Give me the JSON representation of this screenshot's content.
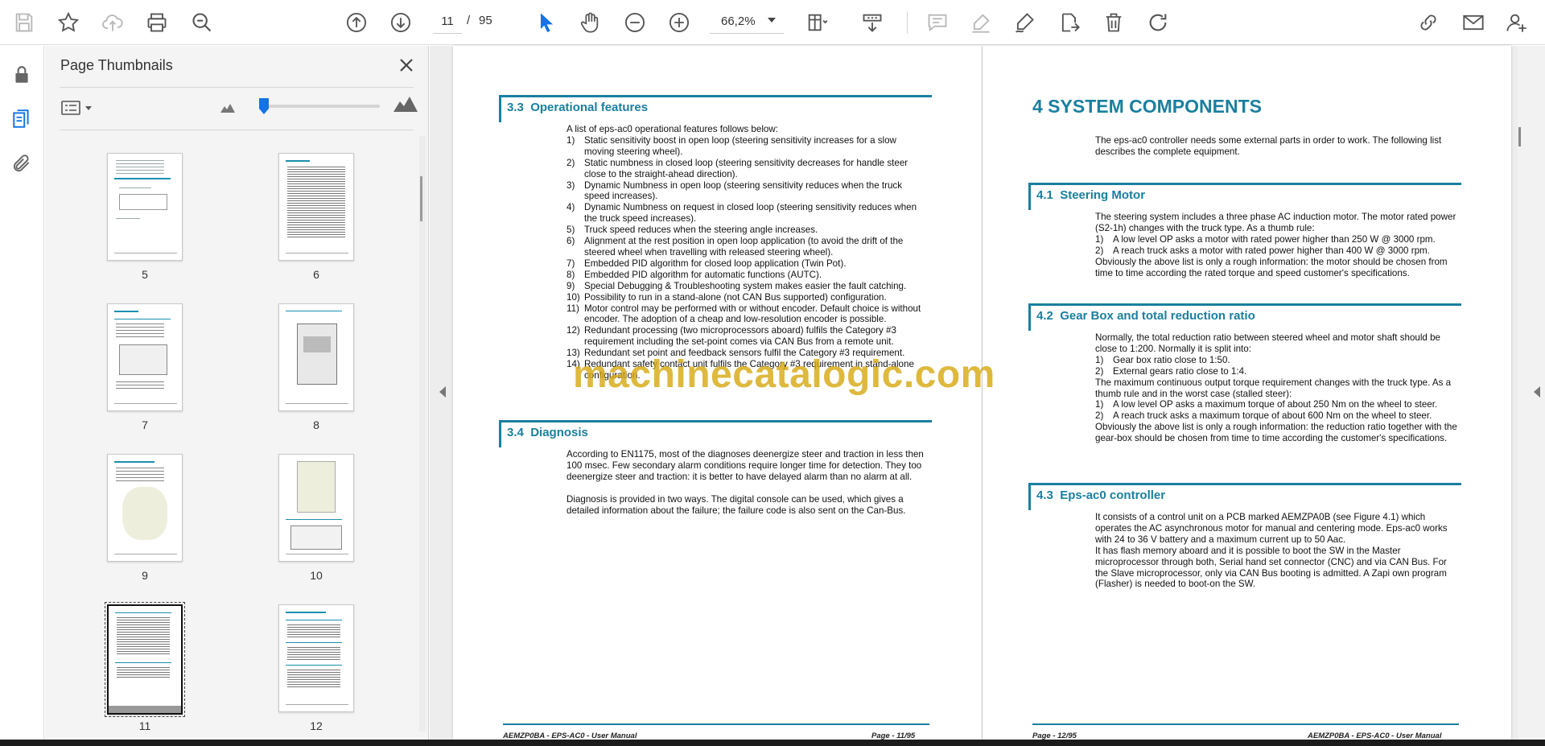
{
  "toolbar": {
    "page_current": "11",
    "page_separator": "/",
    "page_total": "95",
    "zoom": "66,2%"
  },
  "panel": {
    "title": "Page Thumbnails",
    "thumbnails": [
      {
        "label": "5"
      },
      {
        "label": "6"
      },
      {
        "label": "7"
      },
      {
        "label": "8"
      },
      {
        "label": "9"
      },
      {
        "label": "10"
      },
      {
        "label": "11"
      },
      {
        "label": "12"
      }
    ]
  },
  "page11": {
    "s33": {
      "number": "3.3",
      "title": "Operational features",
      "intro": "A list of eps-ac0 operational features follows below:",
      "items": [
        {
          "n": "1)",
          "t": "Static sensitivity boost in open loop (steering sensitivity increases for a slow moving steering wheel)."
        },
        {
          "n": "2)",
          "t": "Static numbness in closed loop (steering sensitivity decreases for handle steer close to the straight-ahead direction)."
        },
        {
          "n": "3)",
          "t": "Dynamic Numbness in open loop (steering sensitivity reduces when the truck speed increases)."
        },
        {
          "n": "4)",
          "t": "Dynamic Numbness on request in closed loop (steering sensitivity reduces when the truck speed increases)."
        },
        {
          "n": "5)",
          "t": "Truck speed reduces when the steering angle increases."
        },
        {
          "n": "6)",
          "t": "Alignment at the rest position in open loop application (to avoid the drift of the steered wheel when travelling with released steering wheel)."
        },
        {
          "n": "7)",
          "t": "Embedded PID algorithm for closed loop application (Twin Pot)."
        },
        {
          "n": "8)",
          "t": "Embedded PID algorithm for automatic functions (AUTC)."
        },
        {
          "n": "9)",
          "t": "Special Debugging & Troubleshooting system makes easier the fault catching."
        },
        {
          "n": "10)",
          "t": "Possibility to run in a stand-alone (not CAN Bus supported) configuration."
        },
        {
          "n": "11)",
          "t": "Motor control may be performed with or without encoder. Default choice is without encoder. The adoption of a cheap and low-resolution encoder is possible."
        },
        {
          "n": "12)",
          "t": "Redundant processing (two microprocessors aboard) fulfils the Category #3 requirement including the set-point comes via CAN Bus from a remote unit."
        },
        {
          "n": "13)",
          "t": "Redundant set point and feedback sensors fulfil the Category #3 requirement."
        },
        {
          "n": "14)",
          "t": "Redundant safety contact unit fulfils the Category #3 requirement in stand-alone configuration."
        }
      ]
    },
    "s34": {
      "number": "3.4",
      "title": "Diagnosis",
      "p1": "According to EN1175, most of the diagnoses deenergize steer and traction in less then 100 msec. Few secondary alarm conditions require longer time for detection. They too deenergize steer and traction: it is better to have delayed alarm than no alarm at all.",
      "p2": "Diagnosis is provided in two ways. The digital console can be used, which gives a detailed information about the failure; the failure code is also sent on the Can-Bus."
    },
    "footer_left": "AEMZP0BA - EPS-AC0 - User Manual",
    "footer_right": "Page - 11/95"
  },
  "page12": {
    "chapter": "4  SYSTEM COMPONENTS",
    "intro": "The eps-ac0 controller needs some external parts in order to work. The following list describes the complete equipment.",
    "s41": {
      "number": "4.1",
      "title": "Steering Motor",
      "p1": "The steering system includes a three phase AC induction motor. The motor rated power (S2-1h) changes with the truck type. As a thumb rule:",
      "items": [
        {
          "n": "1)",
          "t": "A low level OP asks a motor with rated power higher than 250 W @ 3000 rpm."
        },
        {
          "n": "2)",
          "t": "A reach truck asks a motor with rated power higher than 400 W @ 3000 rpm."
        }
      ],
      "p2": "Obviously the above list is only a rough information: the motor should be chosen from time to time according the rated torque and speed customer's specifications."
    },
    "s42": {
      "number": "4.2",
      "title": "Gear Box and total reduction ratio",
      "p1": "Normally, the total reduction ratio between steered wheel and motor shaft should be close to 1:200. Normally it is split into:",
      "items1": [
        {
          "n": "1)",
          "t": "Gear box ratio close to 1:50."
        },
        {
          "n": "2)",
          "t": "External gears ratio close to 1:4."
        }
      ],
      "p2": "The maximum continuous output torque requirement changes with the truck type. As a thumb rule and in the worst case (stalled steer):",
      "items2": [
        {
          "n": "1)",
          "t": "A low level OP asks a maximum torque of about 250 Nm on the wheel to steer."
        },
        {
          "n": "2)",
          "t": "A reach truck asks a maximum torque of about 600 Nm on the wheel to steer."
        }
      ],
      "p3": "Obviously the above list is only a rough information: the reduction ratio together with the gear-box should be chosen from time to time according the customer's specifications."
    },
    "s43": {
      "number": "4.3",
      "title": "Eps-ac0 controller",
      "p1": "It consists of a control unit on a PCB marked AEMZPA0B (see Figure 4.1) which operates the AC asynchronous motor for manual and centering mode. Eps-ac0 works with 24 to 36 V battery and a maximum current up to 50 Aac.",
      "p2": "It has flash memory aboard and it is possible to boot the SW in the Master microprocessor through both, Serial hand set connector (CNC) and via CAN Bus. For the Slave microprocessor, only via CAN Bus booting is admitted. A Zapi own program (Flasher) is needed to boot-on the SW."
    },
    "footer_left": "Page - 12/95",
    "footer_right": "AEMZP0BA - EPS-AC0 - User Manual"
  },
  "watermark": "machinecatalogic.com",
  "colors": {
    "accent_blue": "#1a7fa0",
    "ui_blue": "#1473e6",
    "watermark": "#d7aa14"
  },
  "icons": [
    "save-icon",
    "bookmark-star-icon",
    "upload-cloud-icon",
    "print-icon",
    "zoom-search-icon",
    "page-up-icon",
    "page-down-icon",
    "select-arrow-icon",
    "hand-pan-icon",
    "zoom-out-icon",
    "zoom-in-icon",
    "page-display-icon",
    "scroll-mode-icon",
    "comment-icon",
    "highlight-icon",
    "sign-icon",
    "export-icon",
    "delete-icon",
    "rotate-icon",
    "link-share-icon",
    "mail-icon",
    "add-user-icon",
    "lock-icon",
    "thumbnails-icon",
    "attachment-icon"
  ]
}
